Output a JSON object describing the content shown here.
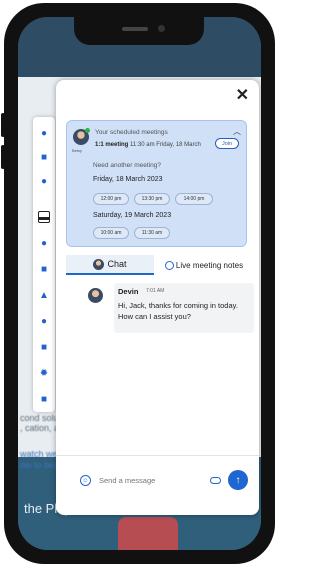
{
  "colors": {
    "accent": "#1f66d1",
    "card_bg": "#cfe0f7",
    "online": "#2bb34a"
  },
  "background": {
    "lines": [
      "cond solution",
      ", cation, and",
      "watch week",
      "ow to begin"
    ],
    "play_text": "the Play button to start."
  },
  "rail": {
    "icons": [
      "mic-icon",
      "video-icon",
      "hand-icon",
      "chat-icon",
      "people-icon",
      "calendar-icon",
      "run-icon",
      "phone-icon",
      "grid-icon",
      "settings-icon",
      "caption-icon"
    ]
  },
  "panel": {
    "close_icon": "close-icon",
    "meeting": {
      "avatar_name": "Betsy",
      "title": "Your scheduled meetings",
      "name": "1:1 meeting",
      "time": "11:30 am Friday, 18 March",
      "join_label": "Join",
      "need_another": "Need another meeting?",
      "days": [
        {
          "label": "Friday, 18 March 2023",
          "slots": [
            "12:00 pm",
            "13:30 pm",
            "14:00 pm"
          ]
        },
        {
          "label": "Saturday, 19 March 2023",
          "slots": [
            "10:00 am",
            "11:30 am"
          ]
        }
      ]
    },
    "tabs": {
      "chat": "Chat",
      "notes": "Live meeting notes"
    },
    "message": {
      "sender": "Devin",
      "time": "7:01 AM",
      "text": "Hi, Jack, thanks for coming in today. How can I assist you?"
    },
    "input": {
      "placeholder": "Send a message"
    }
  }
}
